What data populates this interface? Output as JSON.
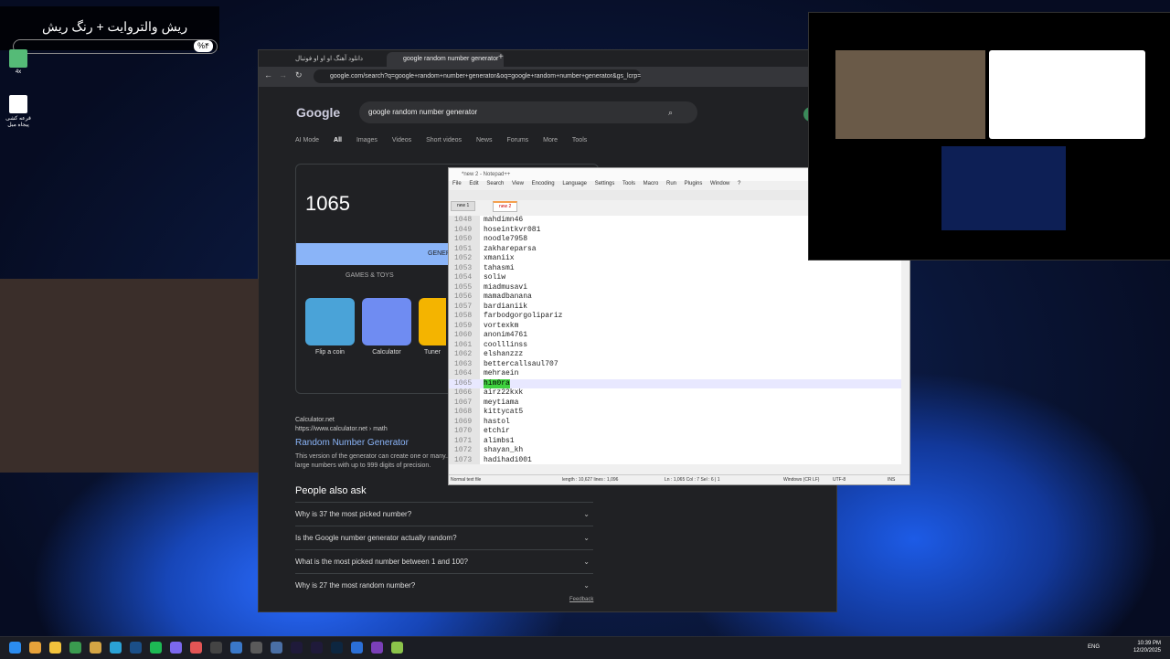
{
  "overlay": {
    "title": "ریش والتروایت + رنگ ریش",
    "percent": "%۴"
  },
  "desktop": {
    "items": [
      {
        "label": "4x"
      },
      {
        "label": "قرعه کشی پیجاه میل"
      }
    ]
  },
  "browser": {
    "tabs": [
      {
        "label": "دانلود آهنگ او او او فوتبال"
      },
      {
        "label": "google random number generator"
      }
    ],
    "url": "google.com/search?q=google+random+number+generator&oq=google+random+number+generator&gs_lcrp=E...",
    "search_query": "google random number generator",
    "search_tabs": [
      "AI Mode",
      "All",
      "Images",
      "Videos",
      "Short videos",
      "News",
      "Forums",
      "More",
      "Tools"
    ],
    "active_search_tab": "All",
    "random_number": "1065",
    "generate_label": "GENERATE",
    "games_label": "GAMES & TOYS",
    "tiles": [
      {
        "label": "Flip a coin",
        "color": "#4aa3d8"
      },
      {
        "label": "Calculator",
        "color": "#6f8cf2"
      },
      {
        "label": "Tuner",
        "color": "#f4b400"
      }
    ],
    "site": {
      "name": "Calculator.net",
      "url": "https://www.calculator.net › math"
    },
    "result_title": "Random Number Generator",
    "snippet": "This version of the generator can create one or many... very large numbers with up to 999 digits of precision.",
    "paa_title": "People also ask",
    "paa": [
      "Why is 37 the most picked number?",
      "Is the Google number generator actually random?",
      "What is the most picked number between 1 and 100?",
      "Why is 27 the most random number?"
    ],
    "feedback": "Feedback"
  },
  "notepad": {
    "title": "*new 2 - Notepad++",
    "menu": [
      "File",
      "Edit",
      "Search",
      "View",
      "Encoding",
      "Language",
      "Settings",
      "Tools",
      "Macro",
      "Run",
      "Plugins",
      "Window",
      "?"
    ],
    "tabs": [
      "new 1",
      "new 2"
    ],
    "lines": [
      {
        "n": "1048",
        "t": "mahdimn46"
      },
      {
        "n": "1049",
        "t": "hoseintkvr081"
      },
      {
        "n": "1050",
        "t": "noodle7958"
      },
      {
        "n": "1051",
        "t": "zakhareparsa"
      },
      {
        "n": "1052",
        "t": "xmaniix"
      },
      {
        "n": "1053",
        "t": "tahasmi"
      },
      {
        "n": "1054",
        "t": "soliw"
      },
      {
        "n": "1055",
        "t": "miadmusavi"
      },
      {
        "n": "1056",
        "t": "mamadbanana"
      },
      {
        "n": "1057",
        "t": "bardianiik"
      },
      {
        "n": "1058",
        "t": "farbodgorgolipariz"
      },
      {
        "n": "1059",
        "t": "vortexkm"
      },
      {
        "n": "1060",
        "t": "anonim4761"
      },
      {
        "n": "1061",
        "t": "coolllinss"
      },
      {
        "n": "1062",
        "t": "elshanzzz"
      },
      {
        "n": "1063",
        "t": "bettercallsaul707"
      },
      {
        "n": "1064",
        "t": "mehraein"
      },
      {
        "n": "1065",
        "t": "him0ra"
      },
      {
        "n": "1066",
        "t": "airz22kxk"
      },
      {
        "n": "1067",
        "t": "meytiama"
      },
      {
        "n": "1068",
        "t": "kittycat5"
      },
      {
        "n": "1069",
        "t": "hastol"
      },
      {
        "n": "1070",
        "t": "etchir"
      },
      {
        "n": "1071",
        "t": "alimbs1"
      },
      {
        "n": "1072",
        "t": "shayan_kh"
      },
      {
        "n": "1073",
        "t": "hadihadi001"
      }
    ],
    "status": {
      "type": "Normal text file",
      "length": "length : 10,627    lines : 1,096",
      "pos": "Ln : 1,065    Col : 7    Sel : 6 | 1",
      "eol": "Windows (CR LF)",
      "enc": "UTF-8",
      "mode": "INS"
    }
  },
  "taskbar": {
    "lang": "ENG",
    "time": "10:39 PM",
    "date": "12/20/2025"
  }
}
